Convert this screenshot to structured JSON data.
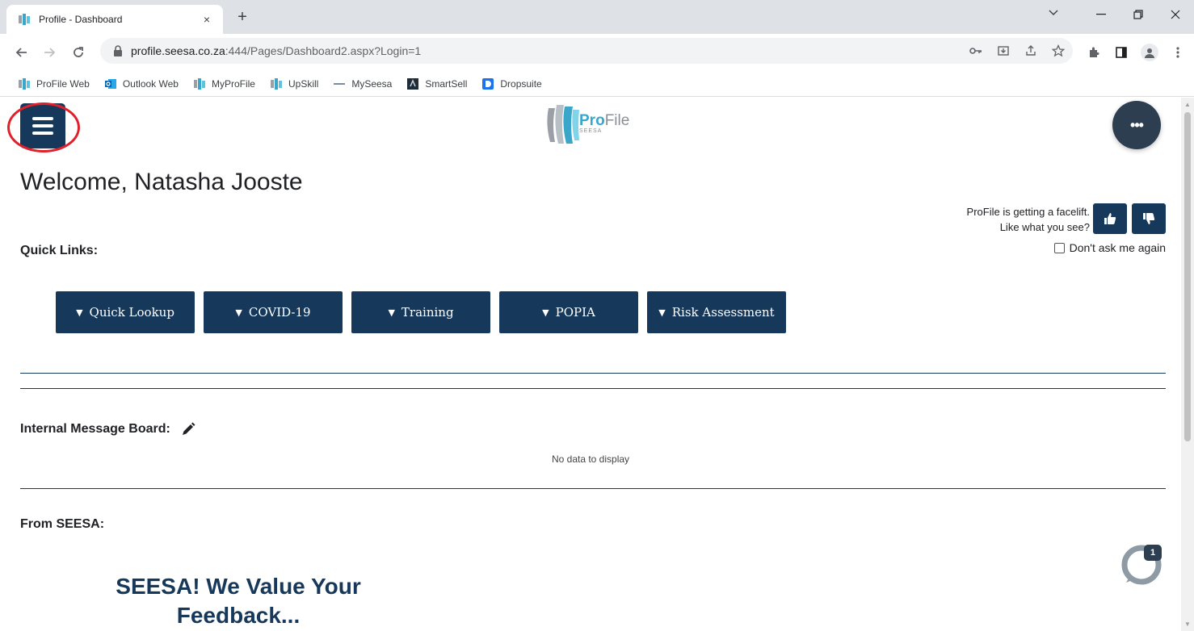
{
  "browser": {
    "tab_title": "Profile - Dashboard",
    "tab_close": "×",
    "new_tab": "+",
    "url_host": "profile.seesa.co.za",
    "url_rest": ":444/Pages/Dashboard2.aspx?Login=1",
    "bookmarks": [
      {
        "label": "ProFile Web",
        "icon": "profile-icon"
      },
      {
        "label": "Outlook Web",
        "icon": "outlook-icon"
      },
      {
        "label": "MyProFile",
        "icon": "profile-icon"
      },
      {
        "label": "UpSkill",
        "icon": "profile-icon"
      },
      {
        "label": "MySeesa",
        "icon": "seesa-icon"
      },
      {
        "label": "SmartSell",
        "icon": "smartsell-icon"
      },
      {
        "label": "Dropsuite",
        "icon": "dropsuite-icon"
      }
    ]
  },
  "page": {
    "logo_pro": "Pro",
    "logo_file": "File",
    "logo_seesa": "SEESA",
    "dots_label": "•••",
    "welcome": "Welcome, Natasha Jooste",
    "facelift_line1": "ProFile is getting a facelift.",
    "facelift_line2": "Like what you see?",
    "dont_ask": "Don't ask me again",
    "quick_links_label": "Quick Links:",
    "quick_links": [
      "Quick Lookup",
      "COVID-19",
      "Training",
      "POPIA",
      "Risk Assessment"
    ],
    "message_board_label": "Internal Message Board:",
    "no_data": "No data to display",
    "from_seesa_label": "From SEESA:",
    "feedback_heading": "SEESA! We Value Your Feedback...",
    "chat_badge": "1"
  },
  "colors": {
    "primary": "#16385a",
    "accent": "#3aa6c9",
    "annotation": "#e0202a"
  }
}
